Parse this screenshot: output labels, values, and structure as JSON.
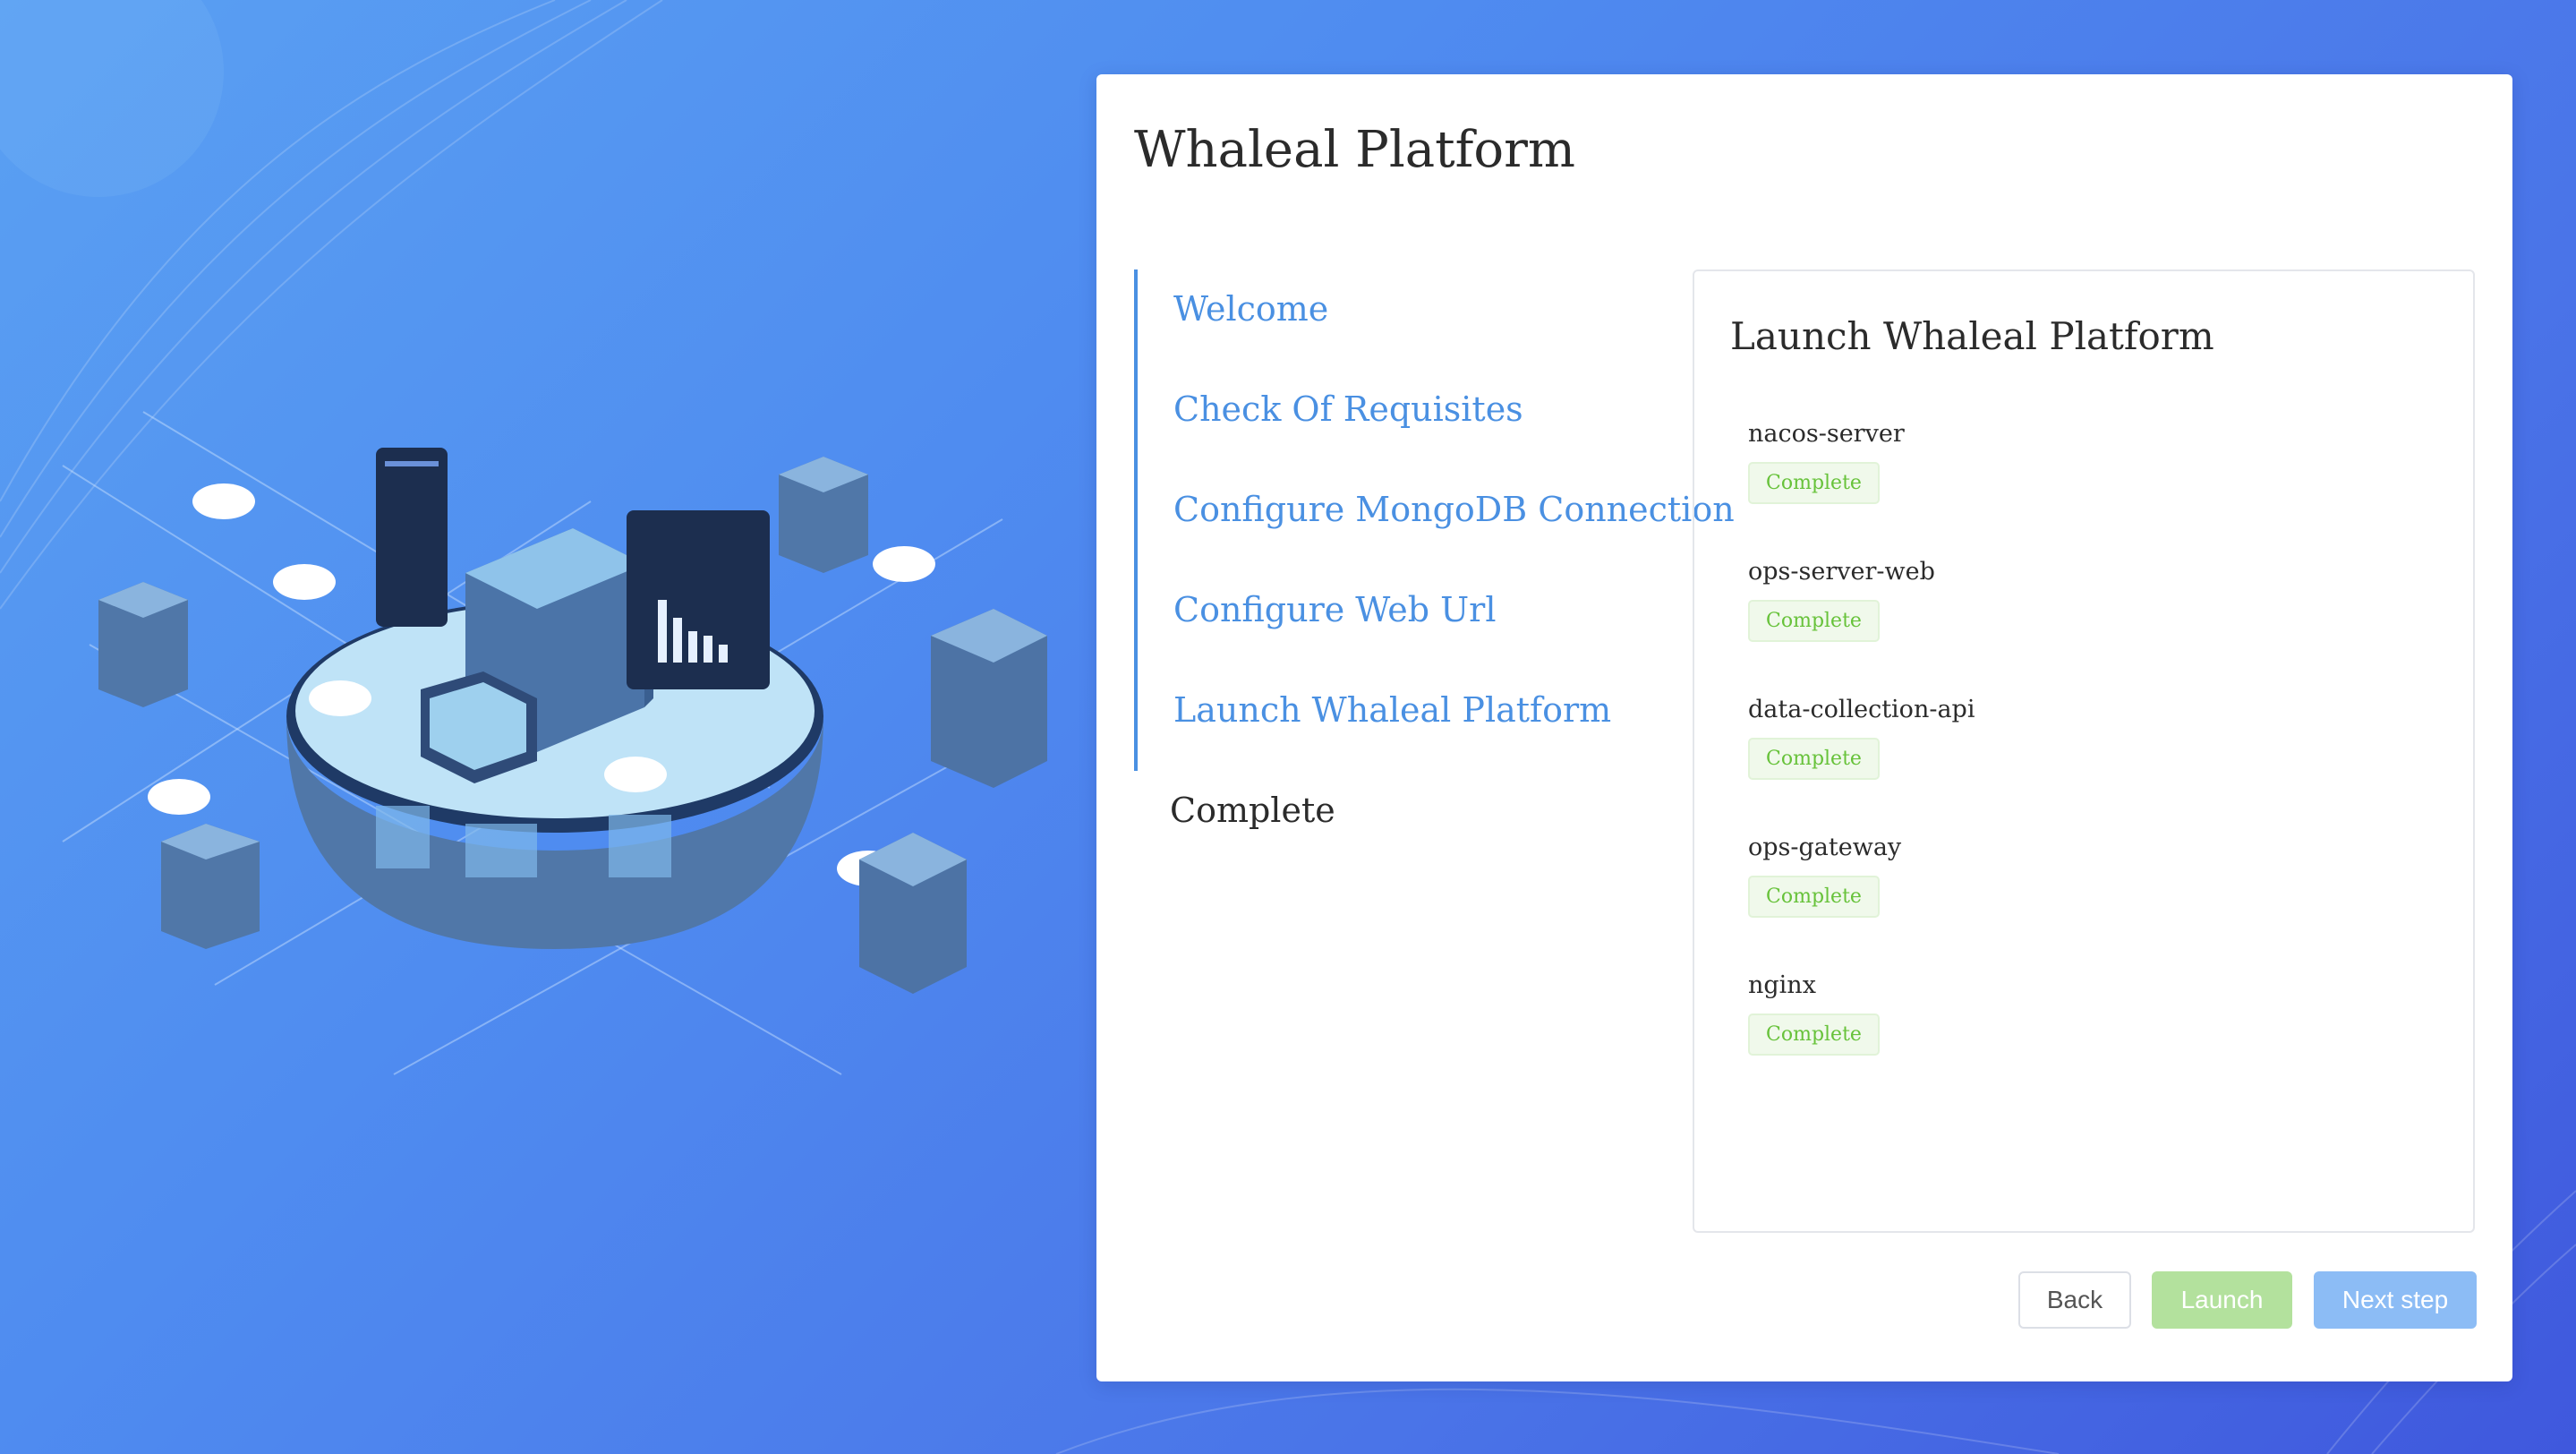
{
  "app": {
    "title": "Whaleal Platform"
  },
  "steps": [
    {
      "label": "Welcome"
    },
    {
      "label": "Check Of Requisites"
    },
    {
      "label": "Configure MongoDB Connection"
    },
    {
      "label": "Configure Web Url"
    },
    {
      "label": "Launch Whaleal Platform"
    },
    {
      "label": "Complete"
    }
  ],
  "panel": {
    "title": "Launch Whaleal Platform",
    "services": [
      {
        "name": "nacos-server",
        "status": "Complete"
      },
      {
        "name": "ops-server-web",
        "status": "Complete"
      },
      {
        "name": "data-collection-api",
        "status": "Complete"
      },
      {
        "name": "ops-gateway",
        "status": "Complete"
      },
      {
        "name": "nginx",
        "status": "Complete"
      }
    ]
  },
  "buttons": {
    "back": "Back",
    "launch": "Launch",
    "next": "Next step"
  },
  "colors": {
    "accent": "#4a90e2",
    "success": "#67c23a",
    "background": "#4f8cf0"
  }
}
